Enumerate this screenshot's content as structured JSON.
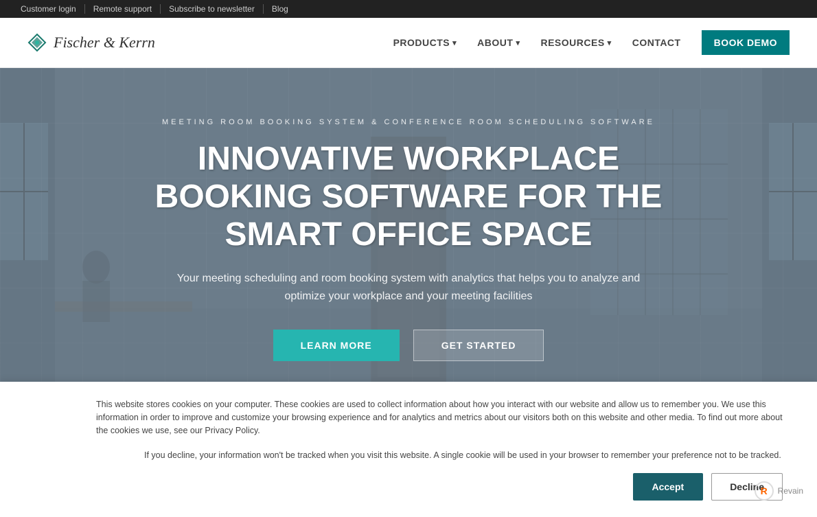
{
  "topbar": {
    "links": [
      "Customer login",
      "Remote support",
      "Subscribe to newsletter",
      "Blog"
    ]
  },
  "header": {
    "logo_text": "Fischer & Kerrn",
    "nav": [
      {
        "label": "PRODUCTS",
        "dropdown": true
      },
      {
        "label": "ABOUT",
        "dropdown": true
      },
      {
        "label": "RESOURCES",
        "dropdown": true
      },
      {
        "label": "CONTACT",
        "dropdown": false
      },
      {
        "label": "BOOK DEMO",
        "dropdown": false,
        "cta": true
      }
    ]
  },
  "hero": {
    "subtitle": "MEETING ROOM BOOKING SYSTEM & CONFERENCE ROOM SCHEDULING SOFTWARE",
    "title": "INNOVATIVE WORKPLACE BOOKING SOFTWARE FOR THE SMART OFFICE SPACE",
    "description": "Your meeting scheduling and room booking system with analytics that helps you to analyze and optimize your workplace and your meeting facilities",
    "btn_primary": "LEARN MORE",
    "btn_secondary": "GET STARTED"
  },
  "cookie": {
    "main_text": "This website stores cookies on your computer. These cookies are used to collect information about how you interact with our website and allow us to remember you. We use this information in order to improve and customize your browsing experience and for analytics and metrics about our visitors both on this website and other media. To find out more about the cookies we use, see our Privacy Policy.",
    "secondary_text": "If you decline, your information won't be tracked when you visit this website. A single cookie will be used in your browser to remember your preference not to be tracked.",
    "accept_label": "Accept",
    "decline_label": "Decline"
  },
  "revain": {
    "label": "Revain"
  }
}
